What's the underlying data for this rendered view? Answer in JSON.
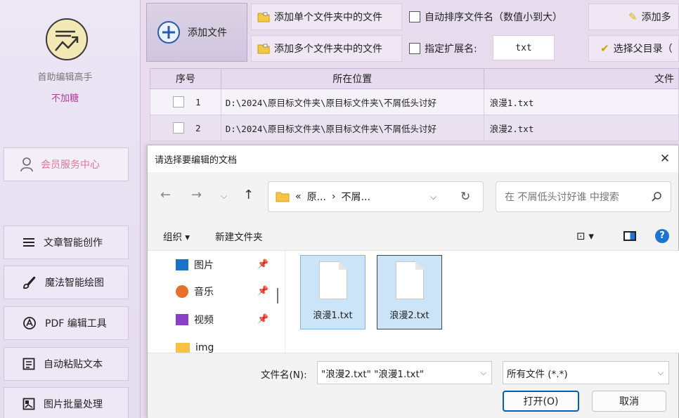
{
  "sidebar": {
    "app_name": "首助编辑高手",
    "app_sub": "不加糖",
    "member_center": "会员服务中心",
    "menu": [
      {
        "label": "文章智能创作",
        "icon": "list-icon"
      },
      {
        "label": "魔法智能绘图",
        "icon": "brush-icon"
      },
      {
        "label": "PDF 编辑工具",
        "icon": "pdf-icon"
      },
      {
        "label": "自动粘贴文本",
        "icon": "paste-icon"
      },
      {
        "label": "图片批量处理",
        "icon": "image-batch-icon"
      }
    ]
  },
  "toolbar": {
    "add_file": "添加文件",
    "add_single_folder": "添加单个文件夹中的文件",
    "add_multi_folder": "添加多个文件夹中的文件",
    "auto_sort": "自动排序文件名（数值小到大）",
    "specify_ext": "指定扩展名:",
    "ext_value": "txt",
    "add_more": "添加多",
    "choose_parent": "选择父目录（"
  },
  "table": {
    "headers": {
      "index": "序号",
      "location": "所在位置",
      "file": "文件"
    },
    "rows": [
      {
        "index": "1",
        "location": "D:\\2024\\原目标文件夹\\原目标文件夹\\不屑低头讨好",
        "file": "浪漫1.txt"
      },
      {
        "index": "2",
        "location": "D:\\2024\\原目标文件夹\\原目标文件夹\\不屑低头讨好",
        "file": "浪漫2.txt"
      }
    ]
  },
  "dialog": {
    "title": "请选择要编辑的文档",
    "address": {
      "prefix": "«",
      "part1": "原...",
      "sep": "›",
      "part2": "不屑..."
    },
    "search_placeholder": "在 不屑低头讨好谁 中搜索",
    "organize": "组织 ▾",
    "new_folder": "新建文件夹",
    "nav_items": [
      {
        "label": "图片",
        "pinned": true
      },
      {
        "label": "音乐",
        "pinned": true
      },
      {
        "label": "视频",
        "pinned": true
      },
      {
        "label": "img",
        "pinned": false
      }
    ],
    "files": [
      {
        "name": "浪漫1.txt"
      },
      {
        "name": "浪漫2.txt"
      }
    ],
    "filename_label": "文件名(N):",
    "filename_value": "\"浪漫2.txt\" \"浪漫1.txt\"",
    "filetype_value": "所有文件 (*.*)",
    "open_button": "打开(O)",
    "cancel_button": "取消"
  },
  "colors": {
    "accent": "#005fb8",
    "sidebar_bg": "#e4dcef",
    "member_text": "#d77a96",
    "app_sub_text": "#b23c9a",
    "selection_bg": "#cce4f7"
  }
}
